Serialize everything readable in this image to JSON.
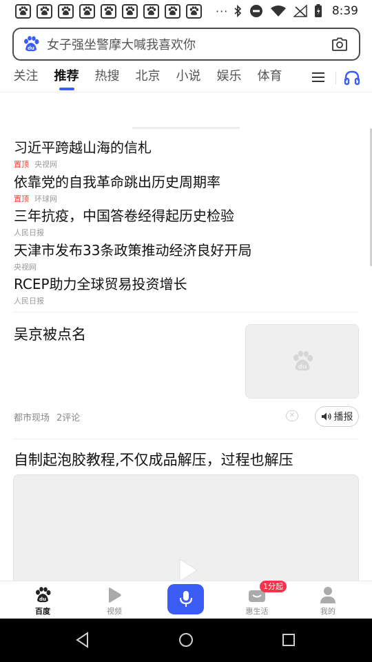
{
  "status_bar": {
    "time": "8:39",
    "notification_count": 9,
    "more": "···"
  },
  "search": {
    "text": "女子强坐警摩大喊我喜欢你"
  },
  "tabs": [
    "关注",
    "推荐",
    "热搜",
    "北京",
    "小说",
    "娱乐",
    "体育"
  ],
  "active_tab": "推荐",
  "headlines": [
    {
      "title": "习近平跨越山海的信札",
      "pin": "置顶",
      "source": "央视网"
    },
    {
      "title": "依靠党的自我革命跳出历史周期率",
      "pin": "置顶",
      "source": "环球网"
    },
    {
      "title": "三年抗疫，中国答卷经得起历史检验",
      "pin": "",
      "source": "人民日报"
    },
    {
      "title": "天津市发布33条政策推动经济良好开局",
      "pin": "",
      "source": "央视网"
    },
    {
      "title": "RCEP助力全球贸易投资增长",
      "pin": "",
      "source": "人民日报"
    }
  ],
  "news_card": {
    "title": "吴京被点名",
    "source": "都市现场",
    "comments": "2评论",
    "play_label": "播报"
  },
  "video_card": {
    "title": "自制起泡胶教程,不仅成品解压，过程也解压"
  },
  "bottom_nav": {
    "items": [
      {
        "label": "百度",
        "icon": "baidu-paw-icon"
      },
      {
        "label": "视频",
        "icon": "video-play-icon"
      },
      {
        "label": "",
        "icon": "microphone-icon"
      },
      {
        "label": "惠生活",
        "icon": "life-icon"
      },
      {
        "label": "我的",
        "icon": "profile-icon"
      }
    ],
    "badge": "1分起"
  },
  "colors": {
    "accent": "#3c5cf6",
    "pin_red": "#e8453c",
    "badge_red": "#f3344a"
  }
}
